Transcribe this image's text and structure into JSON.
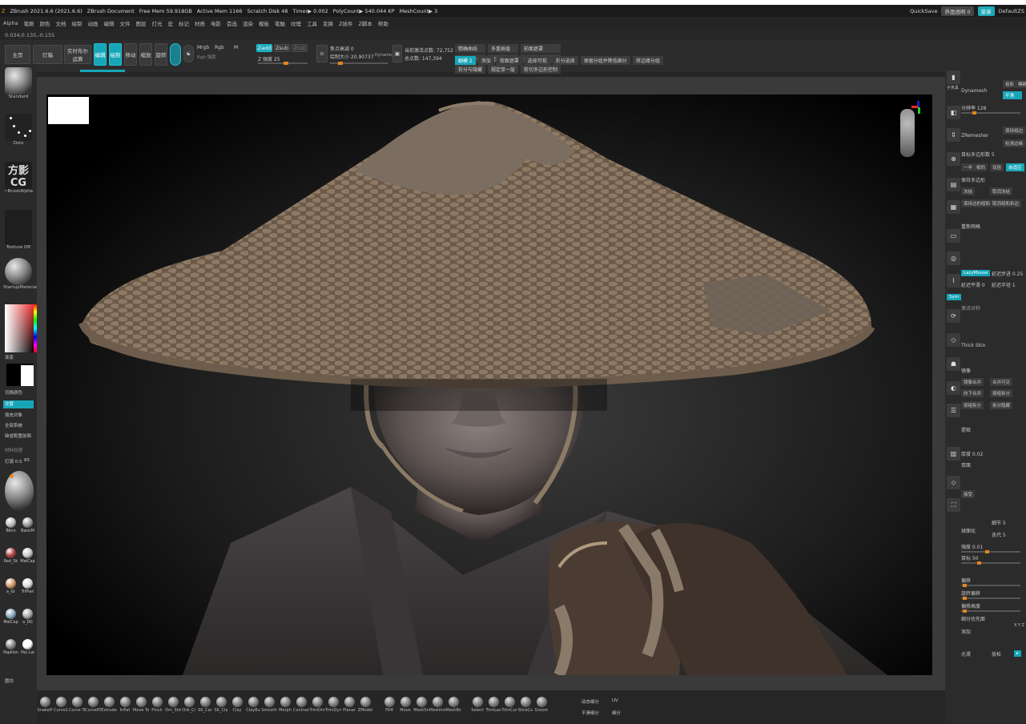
{
  "titlebar": {
    "app": "ZBrush 2021.6.6 (2021.6.6)",
    "doc": "ZBrush Document",
    "free_mem": "Free Mem 59.918GB",
    "active_mem": "Active Mem 1166",
    "scratch": "Scratch Disk 48",
    "timer": "Timer▶ 0.002",
    "polycount": "PolyCount▶ 540.044 KP",
    "meshcount": "MeshCount▶ 3",
    "quicksave": "QuickSave",
    "transparency": "界面透明 0",
    "menu": "菜单",
    "script": "DefaultZS"
  },
  "menubar": [
    "Alpha",
    "笔刷",
    "颜色",
    "文档",
    "绘制",
    "动画",
    "编辑",
    "文件",
    "图层",
    "灯光",
    "宏",
    "标记",
    "材质",
    "电影",
    "首选",
    "渲染",
    "模板",
    "笔触",
    "纹理",
    "工具",
    "变换",
    "Z插件",
    "Z脚本",
    "帮助"
  ],
  "coords": "0.034,0.135,-0.155",
  "toolbar": {
    "home": "主页",
    "lightbox": "灯箱",
    "live_boolean": "实时布尔运算",
    "edit": "编辑",
    "draw": "绘制",
    "move": "移动",
    "scale": "缩放",
    "rotate": "旋转",
    "mrgb": "Mrgb",
    "rgb": "Rgb",
    "m": "M",
    "rgb_intensity": "Rgb 强度",
    "zadd": "Zadd",
    "zsub": "Zsub",
    "zcut": "Zcut",
    "z_intensity": "Z 强度 25",
    "focal": "焦点衰减 0",
    "draw_size": "绘制大小 20.90737",
    "dynamic": "Dynamic",
    "active_points": "当前激活点数: 72,752",
    "total_points": "总点数: 147,394",
    "grid": [
      {
        "label": "精确曲线",
        "cyan": false
      },
      {
        "label": "多重插值",
        "cyan": false
      },
      {
        "label": "前面遮罩",
        "cyan": false
      },
      {
        "label": "四方拓扑",
        "cyan": false
      },
      {
        "label": "遮罩模拟",
        "cyan": false
      },
      {
        "label": "分组边界",
        "cyan": false
      },
      {
        "label": "拆分与隐藏",
        "cyan": false
      },
      {
        "label": "规定单一层",
        "cyan": false
      },
      {
        "label": "剪切多边形控制",
        "cyan": false
      }
    ],
    "grid2": [
      {
        "label": "细模 2",
        "cyan": true
      },
      {
        "label": "添加",
        "cyan": false
      },
      {
        "label": "背面遮罩",
        "cyan": false
      },
      {
        "label": "选择可视",
        "cyan": false
      },
      {
        "label": "折分选择",
        "cyan": false
      },
      {
        "label": "保留分组并降低细分",
        "cyan": false
      },
      {
        "label": "将边缘分组",
        "cyan": false
      }
    ]
  },
  "left_panel": {
    "brush": "Standard",
    "stroke": "Dots",
    "logo": "方影CG",
    "alpha": "~BrushAlpha",
    "texture": "Texture Off",
    "material": "StartupMaterial",
    "gradient": "渐变",
    "switch_color": "切换颜色",
    "alternate": "交替",
    "fill_object": "填充对象",
    "fill_all": "全部系统",
    "fill_layer": "缺省配置前面",
    "lightbox_label": "材料纹理",
    "intensity_label": "灯源 0.5",
    "intensity_value": "85",
    "mats": [
      [
        "Blinn",
        "BasicM"
      ],
      [
        "Red_Sk",
        "MatCap"
      ],
      [
        "a_Gr",
        "TriPlan"
      ],
      [
        "MatCap",
        "a_DG"
      ],
      [
        "Papillon",
        "Pac Lai"
      ]
    ],
    "footer": "图坊"
  },
  "right_panel": {
    "subtool": "子务具",
    "dynamesh": "Dynamesh",
    "project": "投影",
    "blur": "模糊",
    "smooth": "平滑",
    "resolution": "分辨率 128",
    "zremesher": "ZRemesher",
    "keep_groups": "保持组边",
    "detect_edges": "检测边缘",
    "target_poly": "目标多边形数 5",
    "one_half": "一半",
    "same": "相同",
    "double": "双倍",
    "adapt": "自适应",
    "keep_creases": "保持多边形",
    "freeze_border": "冻结",
    "cancel_freeze": "取消冻结",
    "keep_polygroups": "保持边的组和折边",
    "cancel_creases": "取消组和折边",
    "remesh_all": "重新网格",
    "lazymouse": "LazyMouse",
    "lazy_step": "延迟步进 0.25",
    "lazy_smooth": "延迟平滑 0",
    "lazy_radius": "延迟半径 1",
    "symmetry": "激活对称",
    "thick_skin": "Thick Skin",
    "mirror": "镜像",
    "weld": "镜像合并",
    "merge_all": "合并可见",
    "merge_down": "向下合并",
    "split_groups": "按组拆分",
    "split_unmasked": "按组拆分",
    "split_hidden": "拆分隐藏",
    "extract": "提取",
    "shell_thickness": "厚度 0.02",
    "double_label": "双面",
    "accept": "接受",
    "spherize": "球面化",
    "detail": "细节 5",
    "iterations": "迭代 5",
    "strength": "强度 0.01",
    "target": "目标 50",
    "deform1": "偏移",
    "deform2": "旋转偏移",
    "deform3": "偏移高度",
    "deform4": "细分优先面",
    "deform5": "添加",
    "xyz": "X Y Z",
    "smooth_btn": "光滑",
    "relax": "放松"
  },
  "bottom_brushes": [
    "SnakeH",
    "Curve1",
    "Curve Tri",
    "CurveRTri",
    "Extrude",
    "Inflat",
    "Move To",
    "Pinch",
    "Dm_Std",
    "Orb_Cr",
    "SK_Car",
    "SK_Cla",
    "Clay",
    "ClayBu",
    "Smooth",
    "Morph",
    "Contrast",
    "TrimDm",
    "TrimDyn",
    "Planar",
    "ZModel",
    "Fill4",
    "Move",
    "MeshSn",
    "MeshIns",
    "MeshBs",
    "Select",
    "TrimLas",
    "TrimCur",
    "SliceCu",
    "Groom"
  ],
  "bottom_right": {
    "dynamic_detail": "动态细分",
    "uv": "UV",
    "sp_label": "平滑细分",
    "sub": "细分"
  },
  "colors": {
    "accent": "#17a6b8",
    "slider": "#e5851b",
    "panel": "#2b2b2b"
  }
}
